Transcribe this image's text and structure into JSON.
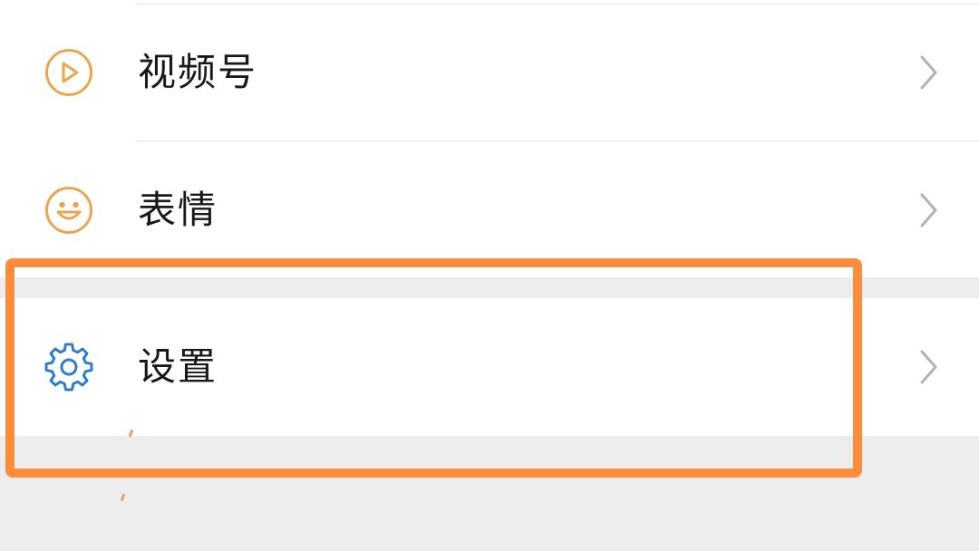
{
  "menu": {
    "items": [
      {
        "label": "视频号",
        "icon": "video-channel-icon"
      },
      {
        "label": "表情",
        "icon": "smiley-icon"
      },
      {
        "label": "设置",
        "icon": "gear-icon"
      }
    ]
  },
  "colors": {
    "icon_orange": "#e9a651",
    "icon_blue": "#2f7cc7",
    "highlight": "#ff8c3b",
    "chevron": "#b2b2b2",
    "background": "#ededed"
  }
}
